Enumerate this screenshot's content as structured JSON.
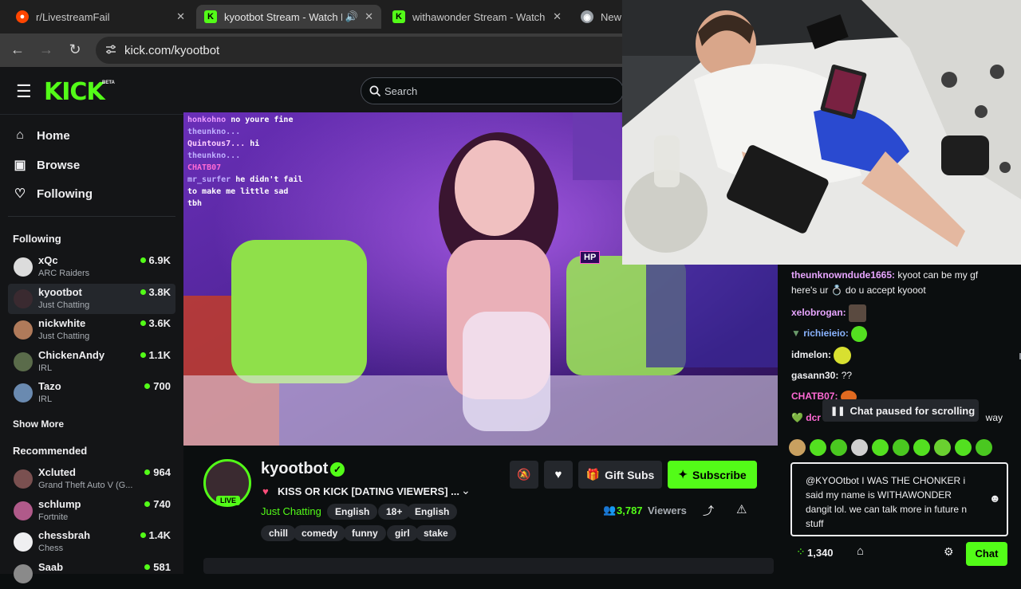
{
  "browser": {
    "tabs": [
      {
        "title": "r/LivestreamFail",
        "active": false
      },
      {
        "title": "kyootbot Stream - Watch Live on Kick",
        "active": true
      },
      {
        "title": "withawonder Stream - Watch Live on Kick",
        "active": false
      },
      {
        "title": "New Tab",
        "active": false
      }
    ],
    "url": "kick.com/kyootbot"
  },
  "kick": {
    "logo": "KICK",
    "beta": "BETA",
    "search_placeholder": "Search",
    "nav": [
      {
        "label": "Home"
      },
      {
        "label": "Browse"
      },
      {
        "label": "Following"
      }
    ],
    "following_title": "Following",
    "following": [
      {
        "name": "xQc",
        "category": "ARC Raiders",
        "viewers": "6.9K"
      },
      {
        "name": "kyootbot",
        "category": "Just Chatting",
        "viewers": "3.8K"
      },
      {
        "name": "nickwhite",
        "category": "Just Chatting",
        "viewers": "3.6K"
      },
      {
        "name": "ChickenAndy",
        "category": "IRL",
        "viewers": "1.1K"
      },
      {
        "name": "Tazo",
        "category": "IRL",
        "viewers": "700"
      }
    ],
    "show_more": "Show More",
    "recommended_title": "Recommended",
    "recommended": [
      {
        "name": "Xcluted",
        "category": "Grand Theft Auto V (G...",
        "viewers": "964"
      },
      {
        "name": "schlump",
        "category": "Fortnite",
        "viewers": "740"
      },
      {
        "name": "chessbrah",
        "category": "Chess",
        "viewers": "1.4K"
      },
      {
        "name": "Saab",
        "category": "",
        "viewers": "581"
      }
    ],
    "overlay_chat": [
      {
        "user": "honkohno",
        "text": "no youre fine"
      },
      {
        "user": "theunkno...",
        "text": ""
      },
      {
        "user": "Quintous7...",
        "text": "hi"
      },
      {
        "user": "theunkno...",
        "text": ""
      },
      {
        "user": "CHATB07",
        "text": ""
      },
      {
        "user": "mr_surfer",
        "text": "he didn't fail to make me little sad tbh"
      }
    ],
    "overlay_hp": "HP",
    "stream": {
      "channel": "kyootbot",
      "live": "LIVE",
      "title": "KISS OR KICK [DATING VIEWERS] ...",
      "category": "Just Chatting",
      "tags_top": [
        "English",
        "18+",
        "English"
      ],
      "tags_bottom": [
        "chill",
        "comedy",
        "funny",
        "girl",
        "stake"
      ],
      "viewers": "3,787",
      "viewers_label": "Viewers",
      "gift_subs": "Gift Subs",
      "subscribe": "Subscribe"
    },
    "chat": {
      "messages": [
        {
          "user": "theunknowndude1665:",
          "text": "kyoot can be my gf here's ur 💍 do u accept kyooot",
          "color": "#e8a6ff"
        },
        {
          "user": "xelobrogan:",
          "text": "",
          "color": "#e8a6ff"
        },
        {
          "user": "richieieio:",
          "text": "",
          "color": "#8ab4ff"
        },
        {
          "user": "idmelon:",
          "text": "",
          "color": "#efeff1"
        },
        {
          "user": "gasann30:",
          "text": "??",
          "color": "#efeff1"
        },
        {
          "user": "CHATB07:",
          "text": "",
          "color": "#ff6ad5"
        },
        {
          "user": "dcr",
          "text": "way",
          "color": "#ff6ad5"
        }
      ],
      "paused": "Chat paused for scrolling",
      "input_text": "@KYOOtbot  I WAS THE CHONKER  i said my name is WITHAWONDER  dangit lol.  we can talk more in future n stuff",
      "points": "1,340",
      "send": "Chat"
    }
  },
  "colors": {
    "accent": "#53fc18",
    "bg": "#0b0e0f",
    "panel": "#141517",
    "tag": "#24272c"
  }
}
